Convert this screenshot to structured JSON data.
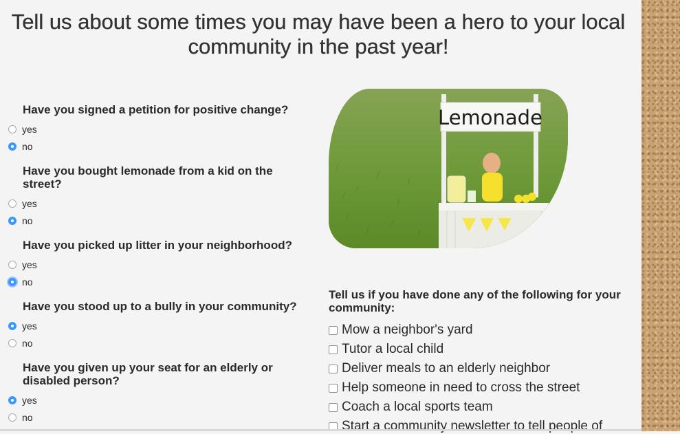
{
  "heading": "Tell us about some times you may have been a hero to your local community in the past year!",
  "questions": [
    {
      "text": "Have you signed a petition for positive change?",
      "options": [
        "yes",
        "no"
      ],
      "selected": "no"
    },
    {
      "text": "Have you bought lemonade from a kid on the street?",
      "options": [
        "yes",
        "no"
      ],
      "selected": "no"
    },
    {
      "text": "Have you picked up litter in your neighborhood?",
      "options": [
        "yes",
        "no"
      ],
      "selected": "no"
    },
    {
      "text": "Have you stood up to a bully in your community?",
      "options": [
        "yes",
        "no"
      ],
      "selected": "yes"
    },
    {
      "text": "Have you given up your seat for an elderly or disabled person?",
      "options": [
        "yes",
        "no"
      ],
      "selected": "yes"
    }
  ],
  "image": {
    "sign_text": "Lemonade"
  },
  "checklist": {
    "heading": "Tell us if you have done any of the following for your community:",
    "items": [
      "Mow a neighbor's yard",
      "Tutor a local child",
      "Deliver meals to an elderly neighbor",
      "Help someone in need to cross the street",
      "Coach a local sports team",
      "Start a community newsletter to tell people of"
    ]
  }
}
